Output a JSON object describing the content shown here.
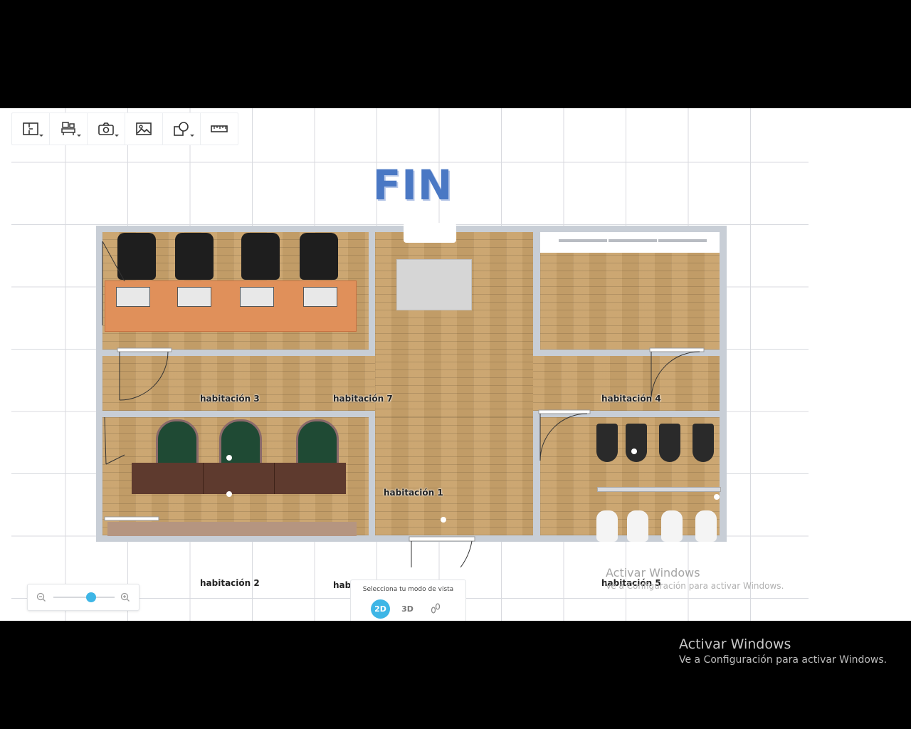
{
  "toolbar": {
    "tools": [
      {
        "name": "floor-plan-tool",
        "icon": "floorplan-icon"
      },
      {
        "name": "furniture-tool",
        "icon": "furniture-icon"
      },
      {
        "name": "camera-tool",
        "icon": "camera-icon"
      },
      {
        "name": "image-tool",
        "icon": "image-icon"
      },
      {
        "name": "shapes-tool",
        "icon": "shapes-icon"
      },
      {
        "name": "measure-tool",
        "icon": "ruler-icon"
      }
    ]
  },
  "plan": {
    "title": "FIN",
    "rooms": {
      "r1": "habitación 1",
      "r2": "habitación 2",
      "r3": "habitación 3",
      "r4": "habitación 4",
      "r5": "habitación 5",
      "r6": "habitación 6",
      "r7": "habitación 7"
    }
  },
  "zoom": {
    "level_fraction": 0.62
  },
  "view_mode": {
    "label": "Selecciona tu modo de vista",
    "options": [
      "2D",
      "3D"
    ],
    "selected": "2D"
  },
  "watermark": {
    "title": "Activar Windows",
    "subtitle": "Ve a Configuración para activar Windows."
  },
  "colors": {
    "accent": "#3eb6e6",
    "title": "#4a78c4"
  }
}
